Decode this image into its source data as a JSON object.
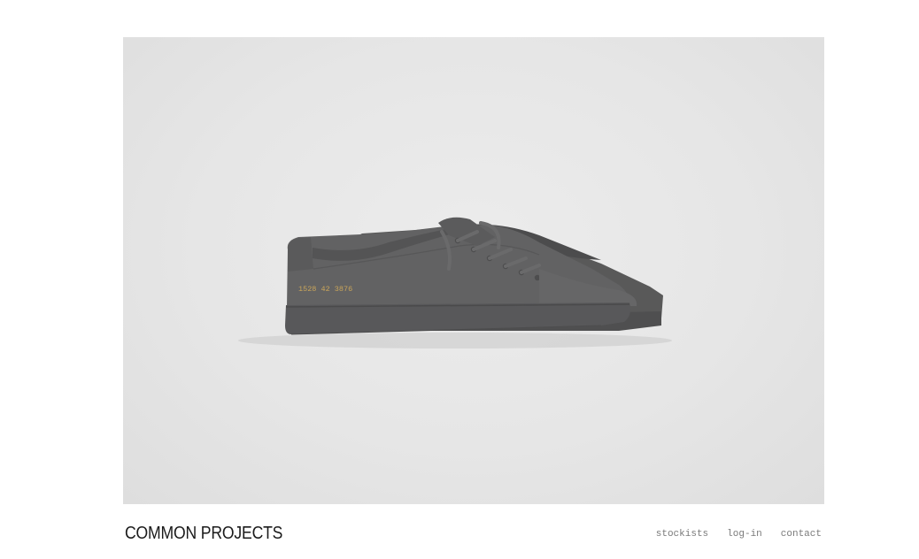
{
  "hero": {
    "image_icon": "sneaker-pair-image",
    "print_code": "1528  42  3876",
    "colors": {
      "background": "#e6e6e6",
      "shoe": "#5f5f60",
      "sole": "#555556",
      "print": "#c9a55a"
    }
  },
  "footer": {
    "brand": "COMMON PROJECTS",
    "nav": [
      {
        "label": "stockists"
      },
      {
        "label": "log-in"
      },
      {
        "label": "contact"
      }
    ]
  }
}
